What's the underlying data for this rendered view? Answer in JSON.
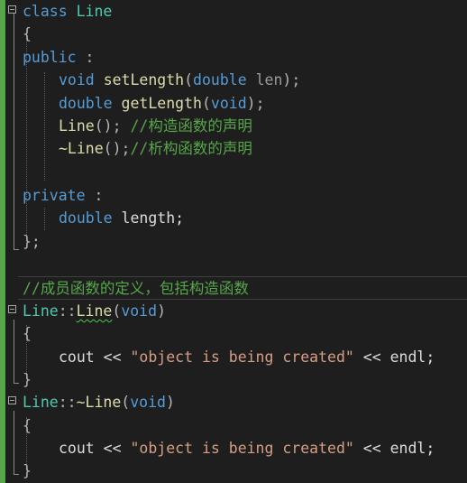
{
  "lines": {
    "l1": {
      "kw": "class",
      "name": "Line"
    },
    "l2": {
      "brace": "{"
    },
    "l3": {
      "kw": "public",
      "colon": " :"
    },
    "l4": {
      "kw": "void",
      "fn": "setLength",
      "open": "(",
      "ptype": "double",
      "param": "len",
      "close": ");"
    },
    "l5": {
      "kw": "double",
      "fn": "getLength",
      "open": "(",
      "ptype": "void",
      "close": ");"
    },
    "l6": {
      "fn": "Line",
      "paren": "(); ",
      "comment": "//构造函数的声明"
    },
    "l7": {
      "fn": "~Line",
      "paren": "();",
      "comment": "//析构函数的声明"
    },
    "l9": {
      "kw": "private",
      "colon": " :"
    },
    "l10": {
      "kw": "double",
      "name": " length;"
    },
    "l11": {
      "brace": "};"
    },
    "l13": {
      "comment": "//成员函数的定义，包括构造函数"
    },
    "l14": {
      "cls": "Line",
      "sep": "::",
      "fn": "Line",
      "open": "(",
      "ptype": "void",
      "close": ")"
    },
    "l15": {
      "brace": "{"
    },
    "l16": {
      "stmt": "cout << ",
      "str": "\"object is being created\"",
      "tail": " << endl;"
    },
    "l17": {
      "brace": "}"
    },
    "l18": {
      "cls": "Line",
      "sep": "::",
      "fn": "~Line",
      "open": "(",
      "ptype": "void",
      "close": ")"
    },
    "l19": {
      "brace": "{"
    },
    "l20": {
      "stmt": "cout << ",
      "str": "\"object is being created\"",
      "tail": " << endl;"
    },
    "l21": {
      "brace": "}"
    }
  },
  "colors": {
    "background": "#1e1e1e",
    "keyword": "#569cd6",
    "type": "#4ec9b0",
    "function": "#dcdcaa",
    "string": "#d69d85",
    "comment": "#57a64a",
    "changed_bar": "#57a64a"
  }
}
